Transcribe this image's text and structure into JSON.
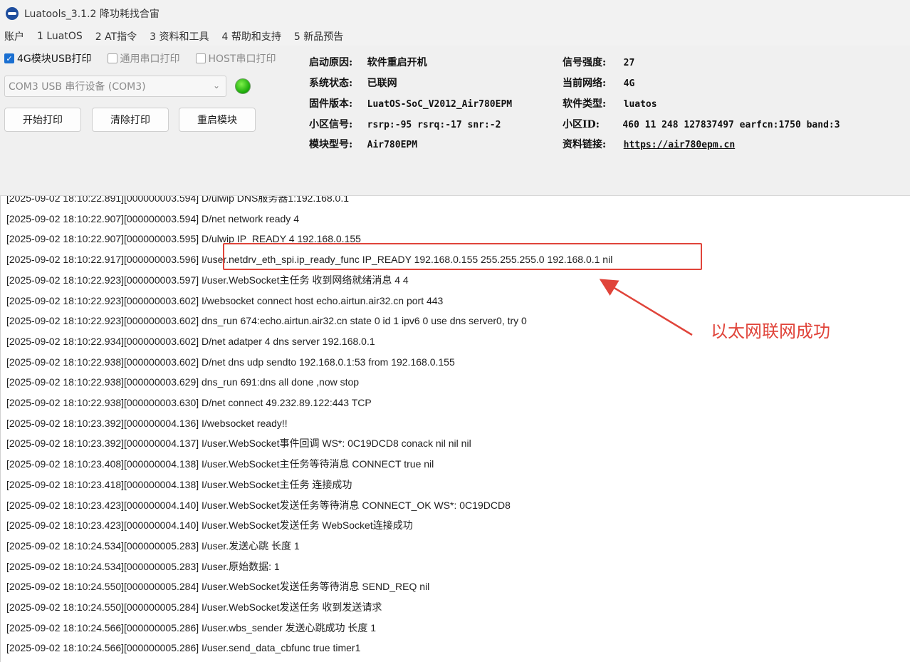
{
  "titlebar": {
    "title": "Luatools_3.1.2 降功耗找合宙"
  },
  "menu": [
    "账户",
    "1 LuatOS",
    "2 AT指令",
    "3 资料和工具",
    "4 帮助和支持",
    "5 新品预告"
  ],
  "options": {
    "usb_print": {
      "label": "4G模块USB打印",
      "checked": true
    },
    "uart_print": {
      "label": "通用串口打印",
      "checked": false
    },
    "host_print": {
      "label": "HOST串口打印",
      "checked": false
    }
  },
  "port": {
    "value": "COM3 USB 串行设备 (COM3)"
  },
  "status_led_color": "#22c30f",
  "buttons": {
    "start": "开始打印",
    "clear": "清除打印",
    "restart": "重启模块"
  },
  "info": {
    "boot_reason_label": "启动原因:",
    "boot_reason": "软件重启开机",
    "sys_state_label": "系统状态:",
    "sys_state": "已联网",
    "firmware_label": "固件版本:",
    "firmware": "LuatOS-SoC_V2012_Air780EPM",
    "cell_signal_label": "小区信号:",
    "cell_signal": "rsrp:-95 rsrq:-17 snr:-2",
    "module_label": "模块型号:",
    "module": "Air780EPM",
    "signal_strength_label": "信号强度:",
    "signal_strength": "27",
    "network_label": "当前网络:",
    "network": "4G",
    "software_type_label": "软件类型:",
    "software_type": "luatos",
    "cell_id_label": "小区ID:",
    "cell_id": "460 11 248 127837497 earfcn:1750 band:3",
    "docs_label": "资料链接:",
    "docs_link": "https://air780epm.cn"
  },
  "log": [
    "[2025-09-02 18:10:22.891][000000003.594] D/ulwip DNS服务器1:192.168.0.1",
    "[2025-09-02 18:10:22.907][000000003.594] D/net network ready 4",
    "[2025-09-02 18:10:22.907][000000003.595] D/ulwip IP_READY 4 192.168.0.155",
    "[2025-09-02 18:10:22.917][000000003.596] I/user.netdrv_eth_spi.ip_ready_func IP_READY 192.168.0.155 255.255.255.0 192.168.0.1 nil",
    "[2025-09-02 18:10:22.923][000000003.597] I/user.WebSocket主任务 收到网络就绪消息 4 4",
    "[2025-09-02 18:10:22.923][000000003.602] I/websocket connect host echo.airtun.air32.cn port 443",
    "[2025-09-02 18:10:22.923][000000003.602] dns_run 674:echo.airtun.air32.cn state 0 id 1 ipv6 0 use dns server0, try 0",
    "[2025-09-02 18:10:22.934][000000003.602] D/net adatper 4 dns server 192.168.0.1",
    "[2025-09-02 18:10:22.938][000000003.602] D/net dns udp sendto 192.168.0.1:53 from 192.168.0.155",
    "[2025-09-02 18:10:22.938][000000003.629] dns_run 691:dns all done ,now stop",
    "[2025-09-02 18:10:22.938][000000003.630] D/net connect 49.232.89.122:443 TCP",
    "[2025-09-02 18:10:23.392][000000004.136] I/websocket ready!!",
    "[2025-09-02 18:10:23.392][000000004.137] I/user.WebSocket事件回调 WS*: 0C19DCD8 conack nil nil nil",
    "[2025-09-02 18:10:23.408][000000004.138] I/user.WebSocket主任务等待消息 CONNECT true nil",
    "[2025-09-02 18:10:23.418][000000004.138] I/user.WebSocket主任务 连接成功",
    "[2025-09-02 18:10:23.423][000000004.140] I/user.WebSocket发送任务等待消息 CONNECT_OK WS*: 0C19DCD8",
    "[2025-09-02 18:10:23.423][000000004.140] I/user.WebSocket发送任务 WebSocket连接成功",
    "[2025-09-02 18:10:24.534][000000005.283] I/user.发送心跳 长度 1",
    "[2025-09-02 18:10:24.534][000000005.283] I/user.原始数据: 1",
    "[2025-09-02 18:10:24.550][000000005.284] I/user.WebSocket发送任务等待消息 SEND_REQ nil",
    "[2025-09-02 18:10:24.550][000000005.284] I/user.WebSocket发送任务 收到发送请求",
    "[2025-09-02 18:10:24.566][000000005.286] I/user.wbs_sender 发送心跳成功 长度 1",
    "[2025-09-02 18:10:24.566][000000005.286] I/user.send_data_cbfunc true timer1"
  ],
  "annotation": {
    "text": "以太网联网成功",
    "color": "#e0443a"
  }
}
